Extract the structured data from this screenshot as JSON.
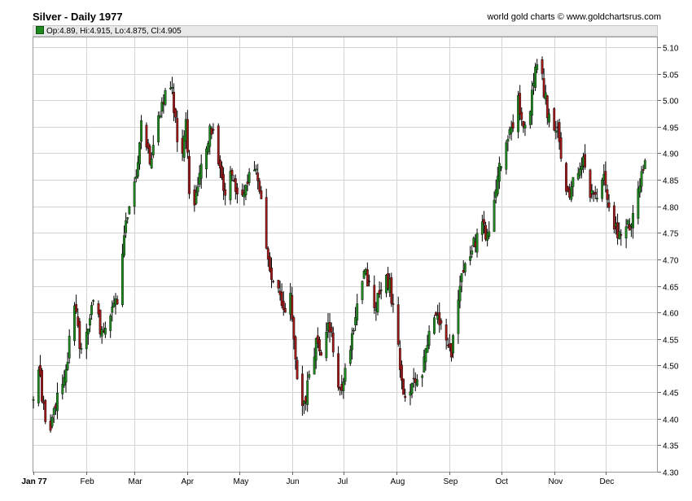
{
  "chart_data": {
    "type": "candlestick",
    "title": "Silver - Daily 1977",
    "source": "world gold charts © www.goldchartsrus.com",
    "last_bar": {
      "label": "Op:4.89, Hi:4.915, Lo:4.875, Cl:4.905"
    },
    "ylim": [
      4.3,
      5.12
    ],
    "y_ticks": [
      "4.30",
      "4.35",
      "4.40",
      "4.45",
      "4.50",
      "4.55",
      "4.60",
      "4.65",
      "4.70",
      "4.75",
      "4.80",
      "4.85",
      "4.90",
      "4.95",
      "5.00",
      "5.05",
      "5.10"
    ],
    "x_ticks": [
      {
        "label": "Jan 77",
        "day": 0,
        "bold": true
      },
      {
        "label": "Feb",
        "day": 31
      },
      {
        "label": "Mar",
        "day": 59
      },
      {
        "label": "Apr",
        "day": 90
      },
      {
        "label": "May",
        "day": 120
      },
      {
        "label": "Jun",
        "day": 151
      },
      {
        "label": "Jul",
        "day": 181
      },
      {
        "label": "Aug",
        "day": 212
      },
      {
        "label": "Sep",
        "day": 243
      },
      {
        "label": "Oct",
        "day": 273
      },
      {
        "label": "Nov",
        "day": 304
      },
      {
        "label": "Dec",
        "day": 334
      }
    ],
    "x_range_days": [
      0,
      364
    ],
    "grid": true,
    "colors": {
      "up": "#1e8a1e",
      "down": "#a01818",
      "wick": "#000000",
      "grid": "#d4d4d4"
    },
    "anchors": [
      {
        "day": 0,
        "close": 4.45
      },
      {
        "day": 3,
        "close": 4.49
      },
      {
        "day": 7,
        "close": 4.4
      },
      {
        "day": 9,
        "close": 4.37
      },
      {
        "day": 12,
        "close": 4.42
      },
      {
        "day": 15,
        "close": 4.46
      },
      {
        "day": 19,
        "close": 4.49
      },
      {
        "day": 22,
        "close": 4.58
      },
      {
        "day": 24,
        "close": 4.62
      },
      {
        "day": 27,
        "close": 4.54
      },
      {
        "day": 30,
        "close": 4.56
      },
      {
        "day": 33,
        "close": 4.59
      },
      {
        "day": 36,
        "close": 4.63
      },
      {
        "day": 39,
        "close": 4.57
      },
      {
        "day": 42,
        "close": 4.56
      },
      {
        "day": 46,
        "close": 4.61
      },
      {
        "day": 49,
        "close": 4.62
      },
      {
        "day": 52,
        "close": 4.72
      },
      {
        "day": 55,
        "close": 4.79
      },
      {
        "day": 58,
        "close": 4.84
      },
      {
        "day": 61,
        "close": 4.88
      },
      {
        "day": 63,
        "close": 4.95
      },
      {
        "day": 66,
        "close": 4.92
      },
      {
        "day": 69,
        "close": 4.88
      },
      {
        "day": 72,
        "close": 4.97
      },
      {
        "day": 76,
        "close": 5.0
      },
      {
        "day": 79,
        "close": 5.05
      },
      {
        "day": 81,
        "close": 5.02
      },
      {
        "day": 83,
        "close": 4.96
      },
      {
        "day": 86,
        "close": 4.88
      },
      {
        "day": 89,
        "close": 4.97
      },
      {
        "day": 91,
        "close": 4.83
      },
      {
        "day": 94,
        "close": 4.79
      },
      {
        "day": 97,
        "close": 4.86
      },
      {
        "day": 100,
        "close": 4.88
      },
      {
        "day": 103,
        "close": 4.96
      },
      {
        "day": 106,
        "close": 4.92
      },
      {
        "day": 109,
        "close": 4.86
      },
      {
        "day": 112,
        "close": 4.82
      },
      {
        "day": 115,
        "close": 4.87
      },
      {
        "day": 118,
        "close": 4.83
      },
      {
        "day": 121,
        "close": 4.79
      },
      {
        "day": 124,
        "close": 4.84
      },
      {
        "day": 127,
        "close": 4.88
      },
      {
        "day": 130,
        "close": 4.86
      },
      {
        "day": 134,
        "close": 4.79
      },
      {
        "day": 138,
        "close": 4.68
      },
      {
        "day": 141,
        "close": 4.66
      },
      {
        "day": 144,
        "close": 4.63
      },
      {
        "day": 147,
        "close": 4.61
      },
      {
        "day": 150,
        "close": 4.63
      },
      {
        "day": 153,
        "close": 4.51
      },
      {
        "day": 156,
        "close": 4.43
      },
      {
        "day": 159,
        "close": 4.44
      },
      {
        "day": 162,
        "close": 4.49
      },
      {
        "day": 165,
        "close": 4.55
      },
      {
        "day": 168,
        "close": 4.52
      },
      {
        "day": 171,
        "close": 4.57
      },
      {
        "day": 174,
        "close": 4.56
      },
      {
        "day": 177,
        "close": 4.47
      },
      {
        "day": 180,
        "close": 4.46
      },
      {
        "day": 184,
        "close": 4.51
      },
      {
        "day": 187,
        "close": 4.58
      },
      {
        "day": 190,
        "close": 4.63
      },
      {
        "day": 193,
        "close": 4.67
      },
      {
        "day": 196,
        "close": 4.66
      },
      {
        "day": 199,
        "close": 4.61
      },
      {
        "day": 202,
        "close": 4.63
      },
      {
        "day": 205,
        "close": 4.66
      },
      {
        "day": 208,
        "close": 4.65
      },
      {
        "day": 211,
        "close": 4.58
      },
      {
        "day": 214,
        "close": 4.5
      },
      {
        "day": 217,
        "close": 4.43
      },
      {
        "day": 220,
        "close": 4.46
      },
      {
        "day": 223,
        "close": 4.48
      },
      {
        "day": 226,
        "close": 4.47
      },
      {
        "day": 229,
        "close": 4.53
      },
      {
        "day": 232,
        "close": 4.57
      },
      {
        "day": 235,
        "close": 4.59
      },
      {
        "day": 238,
        "close": 4.57
      },
      {
        "day": 241,
        "close": 4.54
      },
      {
        "day": 244,
        "close": 4.53
      },
      {
        "day": 247,
        "close": 4.6
      },
      {
        "day": 250,
        "close": 4.68
      },
      {
        "day": 253,
        "close": 4.7
      },
      {
        "day": 256,
        "close": 4.72
      },
      {
        "day": 259,
        "close": 4.74
      },
      {
        "day": 262,
        "close": 4.77
      },
      {
        "day": 265,
        "close": 4.74
      },
      {
        "day": 268,
        "close": 4.77
      },
      {
        "day": 271,
        "close": 4.86
      },
      {
        "day": 274,
        "close": 4.89
      },
      {
        "day": 277,
        "close": 4.92
      },
      {
        "day": 280,
        "close": 4.96
      },
      {
        "day": 283,
        "close": 5.0
      },
      {
        "day": 286,
        "close": 4.94
      },
      {
        "day": 289,
        "close": 4.97
      },
      {
        "day": 292,
        "close": 5.04
      },
      {
        "day": 295,
        "close": 5.07
      },
      {
        "day": 297,
        "close": 5.04
      },
      {
        "day": 300,
        "close": 4.98
      },
      {
        "day": 303,
        "close": 4.92
      },
      {
        "day": 306,
        "close": 4.95
      },
      {
        "day": 309,
        "close": 4.88
      },
      {
        "day": 312,
        "close": 4.82
      },
      {
        "day": 315,
        "close": 4.84
      },
      {
        "day": 318,
        "close": 4.86
      },
      {
        "day": 321,
        "close": 4.88
      },
      {
        "day": 324,
        "close": 4.83
      },
      {
        "day": 327,
        "close": 4.81
      },
      {
        "day": 330,
        "close": 4.83
      },
      {
        "day": 333,
        "close": 4.86
      },
      {
        "day": 336,
        "close": 4.8
      },
      {
        "day": 339,
        "close": 4.76
      },
      {
        "day": 342,
        "close": 4.75
      },
      {
        "day": 345,
        "close": 4.78
      },
      {
        "day": 348,
        "close": 4.76
      },
      {
        "day": 351,
        "close": 4.8
      },
      {
        "day": 354,
        "close": 4.85
      },
      {
        "day": 357,
        "close": 4.89
      },
      {
        "day": 359,
        "close": 4.905
      }
    ]
  }
}
